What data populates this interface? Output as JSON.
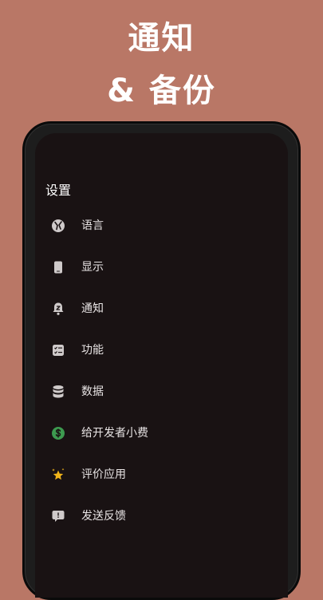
{
  "promo": {
    "line1": "通知",
    "line2": "& 备份"
  },
  "settings": {
    "title": "设置",
    "items": [
      {
        "label": "语言",
        "icon": "language-icon"
      },
      {
        "label": "显示",
        "icon": "display-icon"
      },
      {
        "label": "通知",
        "icon": "notification-icon"
      },
      {
        "label": "功能",
        "icon": "features-icon"
      },
      {
        "label": "数据",
        "icon": "database-icon"
      },
      {
        "label": "给开发者小费",
        "icon": "dollar-icon"
      },
      {
        "label": "评价应用",
        "icon": "star-icon"
      },
      {
        "label": "发送反馈",
        "icon": "feedback-icon"
      }
    ]
  },
  "colors": {
    "background": "#b97766",
    "screen": "#191213",
    "icon_gray": "#cfcaca",
    "tip_green": "#3d9a4f",
    "star_yellow": "#f2b51a"
  }
}
